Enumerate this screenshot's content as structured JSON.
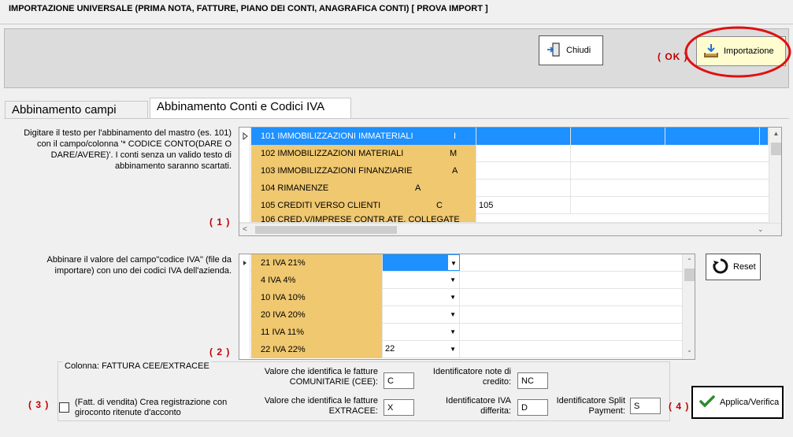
{
  "window": {
    "title": "IMPORTAZIONE  UNIVERSALE (PRIMA NOTA, FATTURE, PIANO DEI CONTI, ANAGRAFICA CONTI)     [ PROVA IMPORT ]"
  },
  "toolbar": {
    "close_label": "Chiudi",
    "import_label": "Importazione",
    "ok_annotation": "( OK )"
  },
  "tabs": [
    {
      "label": "Abbinamento campi"
    },
    {
      "label": "Abbinamento Conti e Codici IVA"
    }
  ],
  "accounts_section": {
    "instructions": "Digitare il testo per l'abbinamento del mastro (es. 101) con il campo/colonna '* CODICE CONTO(DARE O DARE/AVERE)'. I conti senza un valido testo di abbinamento saranno scartati.",
    "annotation": "( 1 )",
    "rows": [
      {
        "name": "101 IMMOBILIZZAZIONI IMMATERIALI",
        "code": "I",
        "value": ""
      },
      {
        "name": "102 IMMOBILIZZAZIONI MATERIALI",
        "code": "M",
        "value": ""
      },
      {
        "name": "103 IMMOBILIZZAZIONI FINANZIARIE",
        "code": "A",
        "value": ""
      },
      {
        "name": "104 RIMANENZE",
        "code": "A",
        "value": ""
      },
      {
        "name": "105 CREDITI VERSO CLIENTI",
        "code": "C",
        "value": "105"
      },
      {
        "name": "106 CRED.V/IMPRESE CONTR.ATE, COLLEGATE",
        "code": "",
        "value": ""
      }
    ]
  },
  "vat_section": {
    "instructions": "Abbinare il valore del campo\"codice IVA\" (file da importare) con uno dei codici IVA dell'azienda.",
    "annotation": "( 2 )",
    "reset_label": "Reset",
    "rows": [
      {
        "name": "21 IVA 21%",
        "value": ""
      },
      {
        "name": "4 IVA 4%",
        "value": ""
      },
      {
        "name": "10 IVA 10%",
        "value": ""
      },
      {
        "name": "20 IVA 20%",
        "value": ""
      },
      {
        "name": "11 IVA 11%",
        "value": ""
      },
      {
        "name": "22 IVA 22%",
        "value": "22"
      }
    ]
  },
  "invoice_section": {
    "column_label": "Colonna:  FATTURA CEE/EXTRACEE",
    "annotation3": "( 3 )",
    "annotation4": "( 4 )",
    "checkbox_label": "(Fatt. di vendita) Crea registrazione con giroconto ritenute d'acconto",
    "checkbox_checked": false,
    "cee_label": "Valore che identifica le fatture COMUNITARIE (CEE):",
    "cee_value": "C",
    "extracee_label": "Valore che identifica le fatture EXTRACEE:",
    "extracee_value": "X",
    "credit_note_label": "Identificatore note di credito:",
    "credit_note_value": "NC",
    "deferred_vat_label": "Identificatore IVA differita:",
    "deferred_vat_value": "D",
    "split_payment_label": "Identificatore Split Payment:",
    "split_payment_value": "S",
    "apply_label": "Applica/Verifica"
  },
  "colors": {
    "highlight_row": "#1e90ff",
    "cell_orange": "#f0c870",
    "annotation_red": "#c00000",
    "import_button_bg": "#fffdd0"
  }
}
